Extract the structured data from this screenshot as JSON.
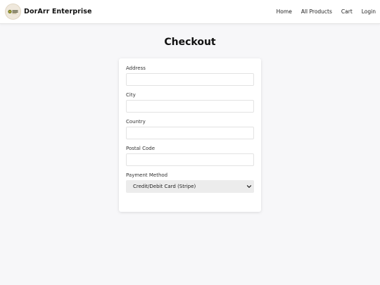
{
  "header": {
    "brand": "DorArr Enterprise",
    "logo_icon": "dorarr-logo-icon",
    "nav": [
      {
        "label": "Home"
      },
      {
        "label": "All Products"
      },
      {
        "label": "Cart"
      },
      {
        "label": "Login"
      }
    ]
  },
  "page": {
    "title": "Checkout"
  },
  "form": {
    "fields": [
      {
        "label": "Address",
        "value": "",
        "placeholder": ""
      },
      {
        "label": "City",
        "value": "",
        "placeholder": ""
      },
      {
        "label": "Country",
        "value": "",
        "placeholder": ""
      },
      {
        "label": "Postal Code",
        "value": "",
        "placeholder": ""
      }
    ],
    "payment": {
      "label": "Payment Method",
      "selected": "Credit/Debit Card (Stripe)",
      "icon": "chevron-down-icon"
    }
  },
  "colors": {
    "page_background": "#f7f7f9",
    "card_background": "#ffffff",
    "select_background": "#ececec"
  }
}
